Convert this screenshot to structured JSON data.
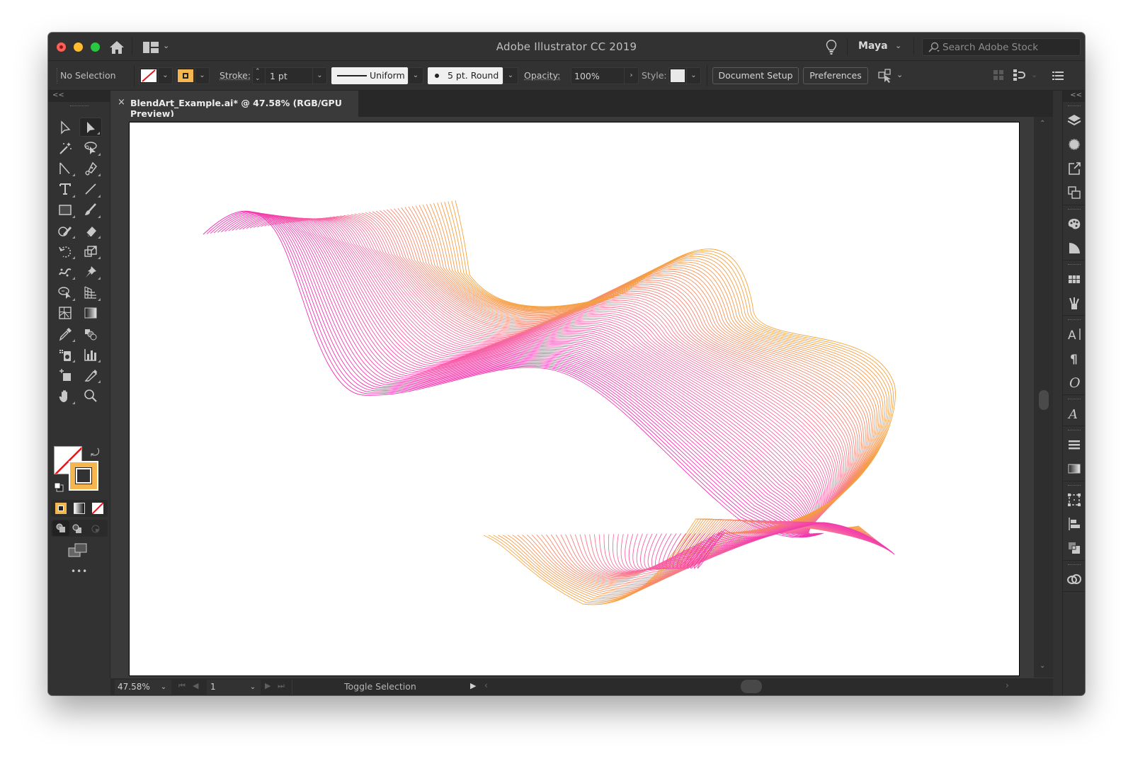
{
  "window": {
    "app_title": "Adobe Illustrator CC 2019",
    "user_name": "Maya",
    "search_placeholder": "Search Adobe Stock"
  },
  "control_bar": {
    "selection_status": "No Selection",
    "fill": "none",
    "stroke_color": "#f5b54f",
    "stroke_label": "Stroke:",
    "stroke_weight": "1 pt",
    "variable_width_profile": "Uniform",
    "brush": "5 pt. Round",
    "opacity_label": "Opacity:",
    "opacity_value": "100%",
    "style_label": "Style:",
    "document_setup_button": "Document Setup",
    "preferences_button": "Preferences"
  },
  "document": {
    "close_symbol": "×",
    "tab_title": "BlendArt_Example.ai* @ 47.58% (RGB/GPU Preview)"
  },
  "artwork": {
    "description": "Blended wave lines",
    "gradient_start": "#f12fb0",
    "gradient_mid": "#f76ea0",
    "gradient_end": "#f5a33c"
  },
  "toolbar": {
    "collapse_symbol": "<<",
    "tools": [
      {
        "name": "direct-selection-tool"
      },
      {
        "name": "selection-tool",
        "active": true
      },
      {
        "name": "magic-wand-tool"
      },
      {
        "name": "lasso-tool"
      },
      {
        "name": "anchor-point-tool"
      },
      {
        "name": "pen-tool"
      },
      {
        "name": "type-tool"
      },
      {
        "name": "line-segment-tool"
      },
      {
        "name": "rectangle-tool"
      },
      {
        "name": "paintbrush-tool"
      },
      {
        "name": "shaper-tool"
      },
      {
        "name": "eraser-tool"
      },
      {
        "name": "rotate-tool"
      },
      {
        "name": "scale-tool"
      },
      {
        "name": "puppet-warp-tool"
      },
      {
        "name": "pin-tool"
      },
      {
        "name": "shape-builder-tool"
      },
      {
        "name": "perspective-grid-tool"
      },
      {
        "name": "mesh-tool"
      },
      {
        "name": "gradient-tool"
      },
      {
        "name": "eyedropper-tool"
      },
      {
        "name": "blend-tool"
      },
      {
        "name": "symbol-sprayer-tool"
      },
      {
        "name": "column-graph-tool"
      },
      {
        "name": "artboard-tool"
      },
      {
        "name": "slice-tool"
      },
      {
        "name": "hand-tool"
      },
      {
        "name": "zoom-tool"
      }
    ],
    "fill_swatch": "none",
    "stroke_swatch": "#f5b54f",
    "more_tools_symbol": "•••"
  },
  "status_bar": {
    "zoom": "47.58%",
    "artboard_number": "1",
    "status_text": "Toggle Selection"
  },
  "right_panel": {
    "collapse_symbol": "<<",
    "groups": [
      [
        "layers",
        "appearance",
        "export-for-screens",
        "artboards"
      ],
      [
        "color",
        "color-guide"
      ],
      [
        "swatches",
        "brushes"
      ],
      [
        "character",
        "paragraph",
        "opentype"
      ],
      [
        "glyphs"
      ],
      [
        "stroke",
        "gradient"
      ],
      [
        "transform",
        "align",
        "pathfinder"
      ],
      [
        "libraries"
      ]
    ]
  }
}
